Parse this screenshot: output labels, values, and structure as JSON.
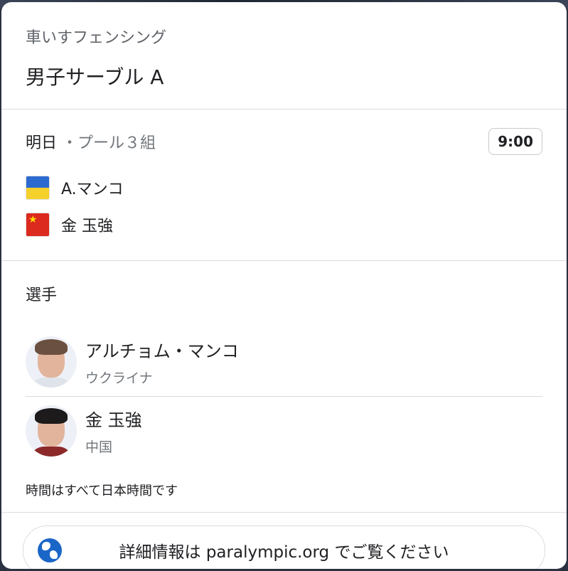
{
  "header": {
    "sport": "車いすフェンシング",
    "event": "男子サーブル A"
  },
  "match": {
    "day": "明日",
    "separator": "・",
    "pool": "プール３組",
    "time": "9:00",
    "competitors": [
      {
        "name": "A.マンコ",
        "flag": "ukraine-flag-icon"
      },
      {
        "name": "金 玉強",
        "flag": "china-flag-icon"
      }
    ]
  },
  "athletes": {
    "title": "選手",
    "items": [
      {
        "name": "アルチョム・マンコ",
        "country": "ウクライナ"
      },
      {
        "name": "金 玉強",
        "country": "中国"
      }
    ]
  },
  "note": "時間はすべて日本時間です",
  "footer": {
    "link_label": "詳細情報は paralympic.org でご覧ください",
    "icon": "globe-icon"
  },
  "colors": {
    "ukraine_blue": "#2d6ad0",
    "ukraine_yellow": "#f6d12c",
    "china_red": "#dc2a1f",
    "globe_blue": "#1a66c8"
  }
}
